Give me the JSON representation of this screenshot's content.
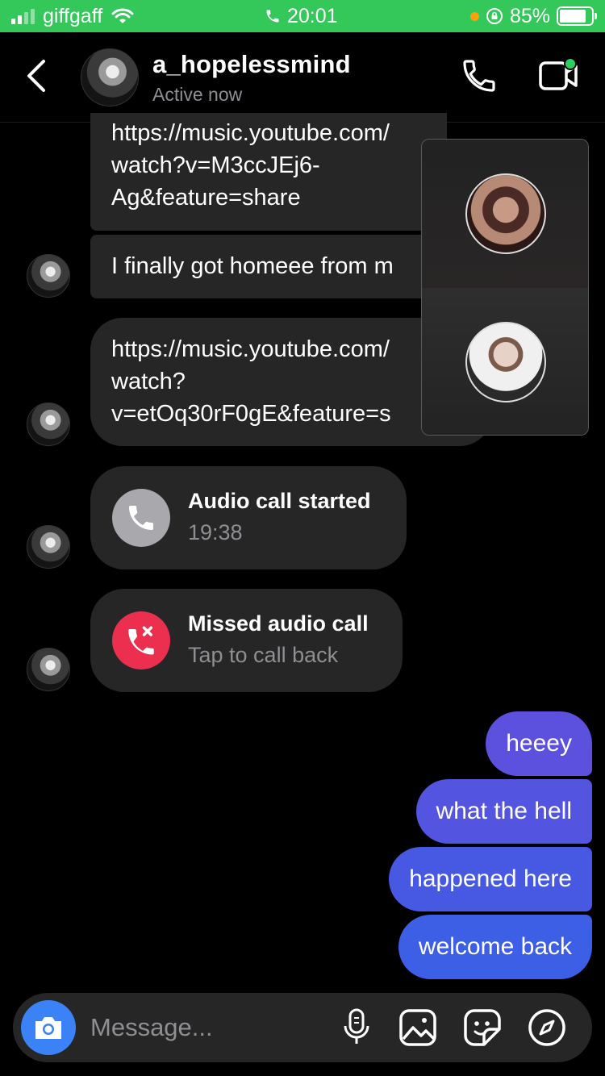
{
  "status_bar": {
    "carrier": "giffgaff",
    "time": "20:01",
    "battery": "85%",
    "battery_level": 0.85
  },
  "header": {
    "username": "a_hopelessmind",
    "status": "Active now",
    "icons": [
      "back-arrow-icon",
      "phone-icon",
      "video-camera-icon"
    ]
  },
  "messages": {
    "link1": [
      "https://music.youtube.com/",
      "watch?v=M3ccJEj6-",
      "Ag&feature=share"
    ],
    "text1": "I finally got homeee from m",
    "link2": [
      "https://music.youtube.com/",
      "watch?",
      "v=etOq30rF0gE&feature=s"
    ],
    "call_started": {
      "title": "Audio call started",
      "time": "19:38"
    },
    "missed_call": {
      "title": "Missed audio call",
      "sub": "Tap to call back"
    },
    "outgoing": [
      "heeey",
      "what the hell",
      "happened here",
      "welcome back"
    ]
  },
  "composer": {
    "placeholder": "Message...",
    "icons": [
      "camera-icon",
      "microphone-icon",
      "gallery-icon",
      "sticker-icon",
      "compass-icon"
    ]
  },
  "colors": {
    "status_green": "#34c759",
    "bubble_in": "#262626",
    "missed_red": "#ed2f4f",
    "outgoing_top": "#5b51de",
    "outgoing_bottom": "#3d5fe6",
    "camera_blue": "#3b82f6"
  }
}
